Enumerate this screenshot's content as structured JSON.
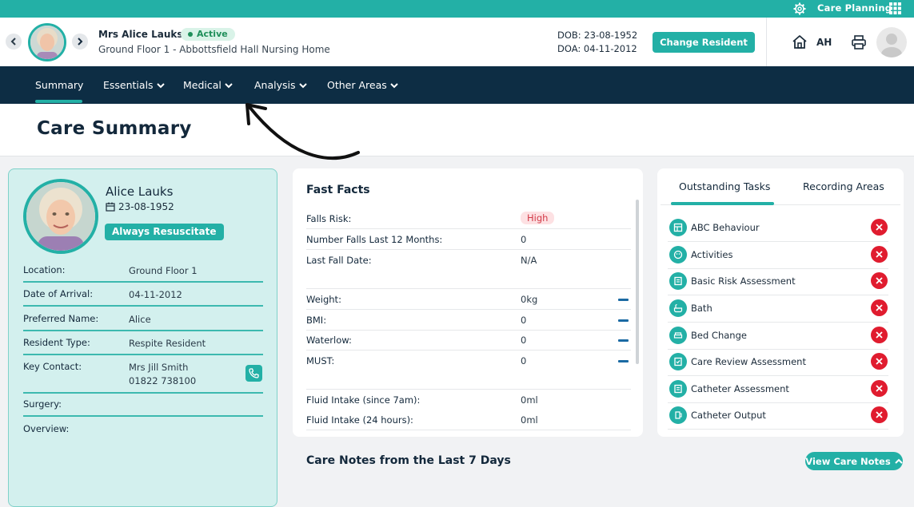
{
  "topbar": {
    "app_label": "Care Planning",
    "icons": [
      "gear-icon",
      "apps-grid-icon"
    ]
  },
  "header": {
    "resident_name": "Mrs Alice Lauks",
    "status": "Active",
    "location": "Ground Floor 1 - Abbottsfield Hall Nursing Home",
    "dob": "DOB: 23-08-1952",
    "doa": "DOA: 04-11-2012",
    "change_label": "Change Resident",
    "user_initials": "AH"
  },
  "nav": {
    "items": [
      {
        "label": "Summary"
      },
      {
        "label": "Essentials"
      },
      {
        "label": "Medical"
      },
      {
        "label": "Analysis"
      },
      {
        "label": "Other Areas"
      }
    ]
  },
  "page": {
    "title": "Care Summary"
  },
  "profile": {
    "name": "Alice Lauks",
    "dob": "23-08-1952",
    "resus": "Always Resuscitate",
    "rows": [
      {
        "k": "Location:",
        "v": "Ground Floor 1"
      },
      {
        "k": "Date of Arrival:",
        "v": "04-11-2012"
      },
      {
        "k": "Preferred Name:",
        "v": "Alice"
      },
      {
        "k": "Resident Type:",
        "v": "Respite Resident"
      },
      {
        "k": "Key Contact:",
        "v1": "Mrs Jill Smith",
        "v2": "01822 738100"
      },
      {
        "k": "Surgery:",
        "v": ""
      },
      {
        "k": "Overview:",
        "v": ""
      }
    ]
  },
  "fast_facts": {
    "title": "Fast Facts",
    "rows": [
      {
        "k": "Falls Risk:",
        "v": "High"
      },
      {
        "k": "Number Falls Last 12 Months:",
        "v": "0"
      },
      {
        "k": "Last Fall Date:",
        "v": "N/A"
      },
      {
        "k": "Weight:",
        "v": "0kg"
      },
      {
        "k": "BMI:",
        "v": "0"
      },
      {
        "k": "Waterlow:",
        "v": "0"
      },
      {
        "k": "MUST:",
        "v": "0"
      },
      {
        "k": "Fluid Intake (since 7am):",
        "v": "0ml"
      },
      {
        "k": "Fluid Intake (24 hours):",
        "v": "0ml"
      }
    ]
  },
  "tasks": {
    "tabs": [
      "Outstanding Tasks",
      "Recording Areas"
    ],
    "items": [
      {
        "label": "ABC Behaviour"
      },
      {
        "label": "Activities"
      },
      {
        "label": "Basic Risk Assessment"
      },
      {
        "label": "Bath"
      },
      {
        "label": "Bed Change"
      },
      {
        "label": "Care Review Assessment"
      },
      {
        "label": "Catheter Assessment"
      },
      {
        "label": "Catheter Output"
      }
    ]
  },
  "care_notes": {
    "title": "Care Notes from the Last 7 Days",
    "button": "View Care Notes"
  },
  "colors": {
    "teal": "#23b0a6",
    "navy": "#0d2d44",
    "red": "#e01c2f"
  }
}
